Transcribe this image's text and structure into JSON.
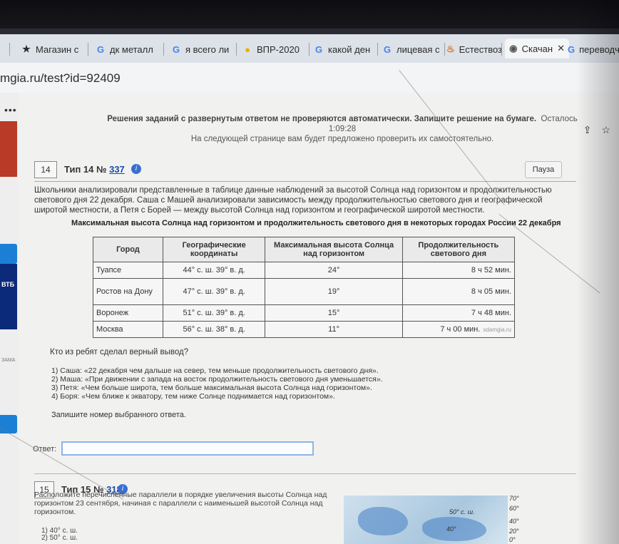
{
  "browser": {
    "tabs": [
      {
        "icon": "bookmark-icon",
        "label": "Магазин с"
      },
      {
        "icon": "google-icon",
        "label": "дк металл"
      },
      {
        "icon": "google-icon",
        "label": "я всего ли"
      },
      {
        "icon": "star-badge-icon",
        "label": "ВПР-2020"
      },
      {
        "icon": "google-icon",
        "label": "какой ден"
      },
      {
        "icon": "google-icon",
        "label": "лицевая с"
      },
      {
        "icon": "flame-icon",
        "label": "Естествоз"
      },
      {
        "icon": "chrome-icon",
        "label": "Скачан"
      },
      {
        "icon": "google-icon",
        "label": "переводч"
      }
    ],
    "active_close": "✕",
    "url": "mgia.ru/test?id=92409"
  },
  "notice": {
    "line1": "Решения заданий с развернутым ответом не проверяются автоматически. Запишите решение на бумаге.",
    "remaining": "Осталось 1:09:28",
    "line2": "На следующей странице вам будет предложено проверить их самостоятельно."
  },
  "task14": {
    "number": "14",
    "type_prefix": "Тип 14 №",
    "id": "337",
    "pause": "Пауза",
    "text": "Школьники анализировали представленные в таблице данные наблюдений за высотой Солнца над горизонтом и продолжительностью светового дня 22 декабря. Саша с Машей анализировали зависимость между продолжительностью светового дня и географической широтой местности, а Петя с Борей — между высотой Солнца над горизонтом и географической широтой местности.",
    "table_title": "Максимальная высота Солнца над горизонтом и продолжительность светового дня в некоторых городах России 22 декабря",
    "columns": [
      "Город",
      "Географические координаты",
      "Максимальная высота Солнца над горизонтом",
      "Продолжительность светового дня"
    ],
    "rows": [
      [
        "Туапсе",
        "44° с. ш. 39° в. д.",
        "24°",
        "8 ч 52 мин."
      ],
      [
        "Ростов на Дону",
        "47° с. ш. 39° в. д.",
        "19°",
        "8 ч 05 мин."
      ],
      [
        "Воронеж",
        "51° с. ш. 39° в. д.",
        "15°",
        "7 ч 48 мин."
      ],
      [
        "Москва",
        "56° с. ш. 38° в. д.",
        "11°",
        "7 ч 00 мин."
      ]
    ],
    "watermark": "sdamgia.ru",
    "question": "Кто из ребят сделал верный вывод?",
    "options": [
      "1) Саша: «22 декабря чем дальше на север, тем меньше продолжительность светового дня».",
      "2) Маша: «При движении с запада на восток продолжительность светового дня уменьшается».",
      "3) Петя: «Чем больше широта, тем больше максимальная высота Солнца над горизонтом».",
      "4) Боря: «Чем ближе к экватору, тем ниже Солнце поднимается над горизонтом»."
    ],
    "instruction": "Запишите номер выбранного ответа.",
    "answer_label": "Ответ:",
    "answer_value": ""
  },
  "task15": {
    "number": "15",
    "type_prefix": "Тип 15 №",
    "id": "318",
    "text": "Расположите перечисленные параллели в порядке увеличения высоты Солнца над горизонтом 23 сентября, начиная с параллели с наименьшей высотой Солнца над горизонтом.",
    "options": [
      "1) 40° с. ш.",
      "2) 50° с. ш."
    ],
    "map_labels": [
      "50° с. ш.",
      "40°"
    ],
    "map_lat_labels": [
      "70°",
      "60°",
      "40°",
      "20°",
      "0°"
    ]
  },
  "side": {
    "menu": "•••",
    "ad_text": "ВТБ",
    "mark": "ЗАМА"
  }
}
